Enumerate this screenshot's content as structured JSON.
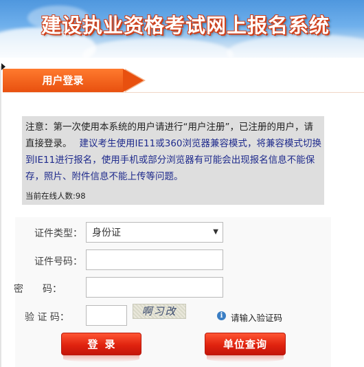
{
  "header": {
    "title": "建设执业资格考试网上报名系统"
  },
  "tab": {
    "label": "用户登录"
  },
  "notice": {
    "text_plain": "注意：第一次使用本系统的用户请进行“用户注册”，已注册的用户，请直接登录。",
    "text_blue": "建议考生使用IE11或360浏览器兼容模式，将兼容模式切换到IE11进行报名，使用手机或部分浏览器有可能会出现报名信息不能保存，照片、附件信息不能上传等问题。",
    "online_count": "当前在线人数:98"
  },
  "form": {
    "id_type_label": "证件类型：",
    "id_type_value": "身份证",
    "id_number_label": "证件号码：",
    "id_number_value": "",
    "password_label": "密　　码：",
    "password_value": "",
    "captcha_label": "验 证 码：",
    "captcha_value": "",
    "captcha_image_text": "啊习改",
    "captcha_hint": "请输入验证码"
  },
  "buttons": {
    "login": "登录",
    "unit_query": "单位查询"
  },
  "colors": {
    "accent": "#e8500f",
    "button_red": "#e0230f",
    "notice_blue": "#1e2a8c",
    "header_blue": "#4f97de"
  },
  "icons": {
    "hint_icon": "info-icon",
    "select_arrow": "chevron-down-icon"
  }
}
